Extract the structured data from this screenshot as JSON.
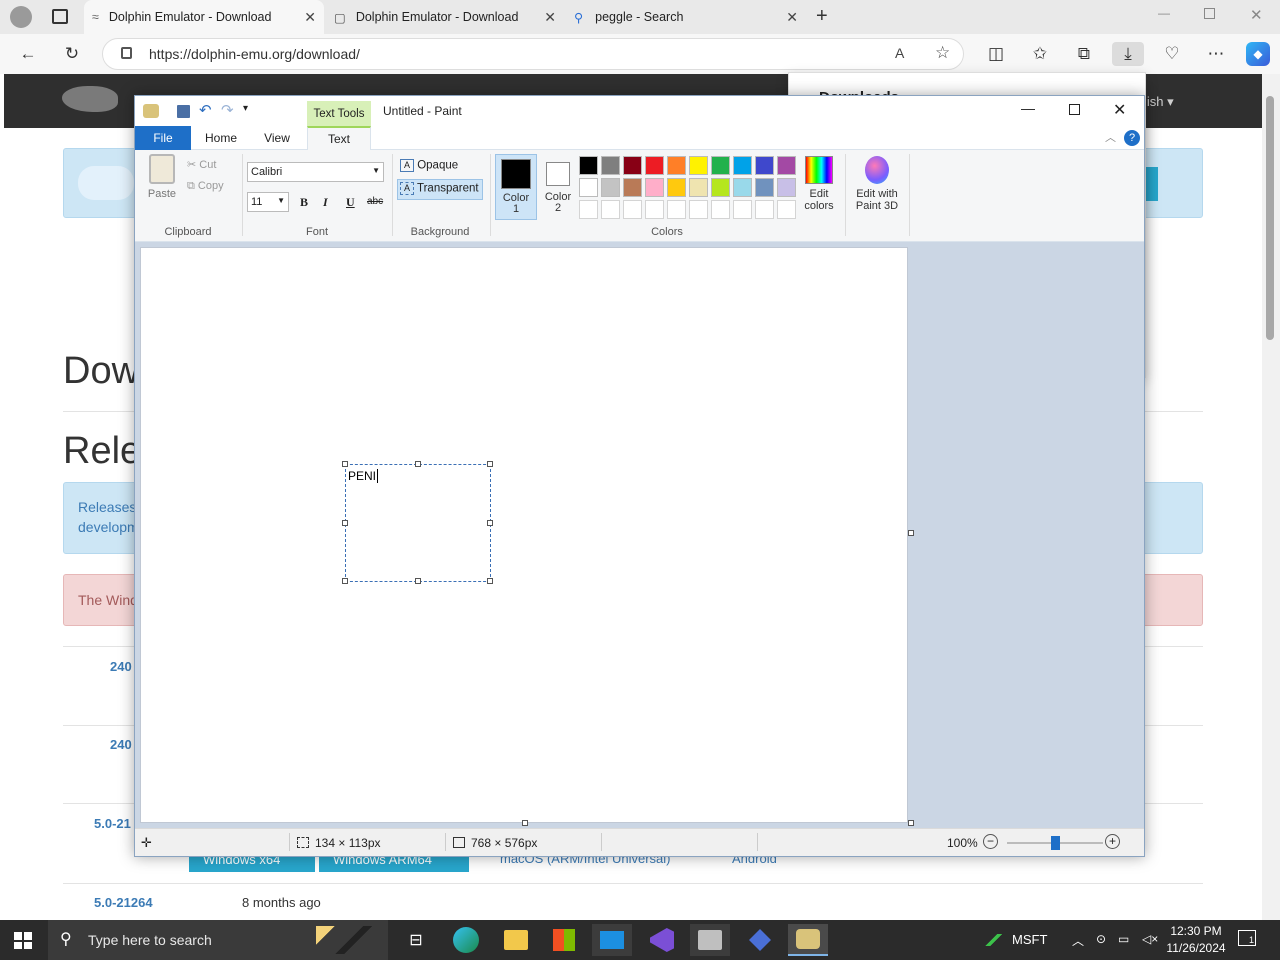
{
  "browser": {
    "tabs": [
      {
        "title": "Dolphin Emulator - Download",
        "active": true
      },
      {
        "title": "Dolphin Emulator - Download",
        "active": false
      },
      {
        "title": "peggle - Search",
        "active": false
      }
    ],
    "url": "https://dolphin-emu.org/download/",
    "downloads_panel_title": "Downloads"
  },
  "website": {
    "language_partial": "lish",
    "heading_download_partial": "Dow",
    "heading_releases_partial": "Rele",
    "info_line1_partial": "Releases",
    "info_line2_partial": "developm",
    "warning_partial": "The Wind",
    "rows": [
      {
        "version": "240"
      },
      {
        "version": "240"
      },
      {
        "version": "5.0-21"
      },
      {
        "version": "5.0-21264",
        "age": "8 months ago"
      }
    ],
    "download_buttons": [
      "Windows x64",
      "Windows ARM64"
    ],
    "download_links": [
      "macOS (ARM/Intel Universal)",
      "Android"
    ]
  },
  "paint": {
    "window_title": "Untitled - Paint",
    "context_tab": "Text Tools",
    "tabs": [
      "File",
      "Home",
      "View",
      "Text"
    ],
    "clipboard": {
      "paste": "Paste",
      "cut": "Cut",
      "copy": "Copy",
      "label": "Clipboard"
    },
    "font": {
      "family": "Calibri",
      "size": "11",
      "bold": "B",
      "italic": "I",
      "underline": "U",
      "strike": "abc",
      "label": "Font"
    },
    "background": {
      "opaque": "Opaque",
      "transparent": "Transparent",
      "label": "Background"
    },
    "colors": {
      "color1_line1": "Color",
      "color1_line2": "1",
      "color2_line1": "Color",
      "color2_line2": "2",
      "edit_line1": "Edit",
      "edit_line2": "colors",
      "paint3d_line1": "Edit with",
      "paint3d_line2": "Paint 3D",
      "label": "Colors",
      "color1": "#000000",
      "color2": "#ffffff",
      "palette_row1": [
        "#000000",
        "#7f7f7f",
        "#880015",
        "#ed1c24",
        "#ff7f27",
        "#fff200",
        "#22b14c",
        "#00a2e8",
        "#3f48cc",
        "#a349a4"
      ],
      "palette_row2": [
        "#ffffff",
        "#c3c3c3",
        "#b97a57",
        "#ffaec9",
        "#ffc90e",
        "#efe4b0",
        "#b5e61d",
        "#99d9ea",
        "#7092be",
        "#c8bfe7"
      ]
    },
    "text_content": "PENI",
    "status": {
      "selection": "134 × 113px",
      "canvas": "768 × 576px",
      "zoom": "100%",
      "zoom_level": 0.5
    }
  },
  "taskbar": {
    "search_placeholder": "Type here to search",
    "stock": "MSFT",
    "time": "12:30 PM",
    "date": "11/26/2024",
    "notifications": "1"
  }
}
